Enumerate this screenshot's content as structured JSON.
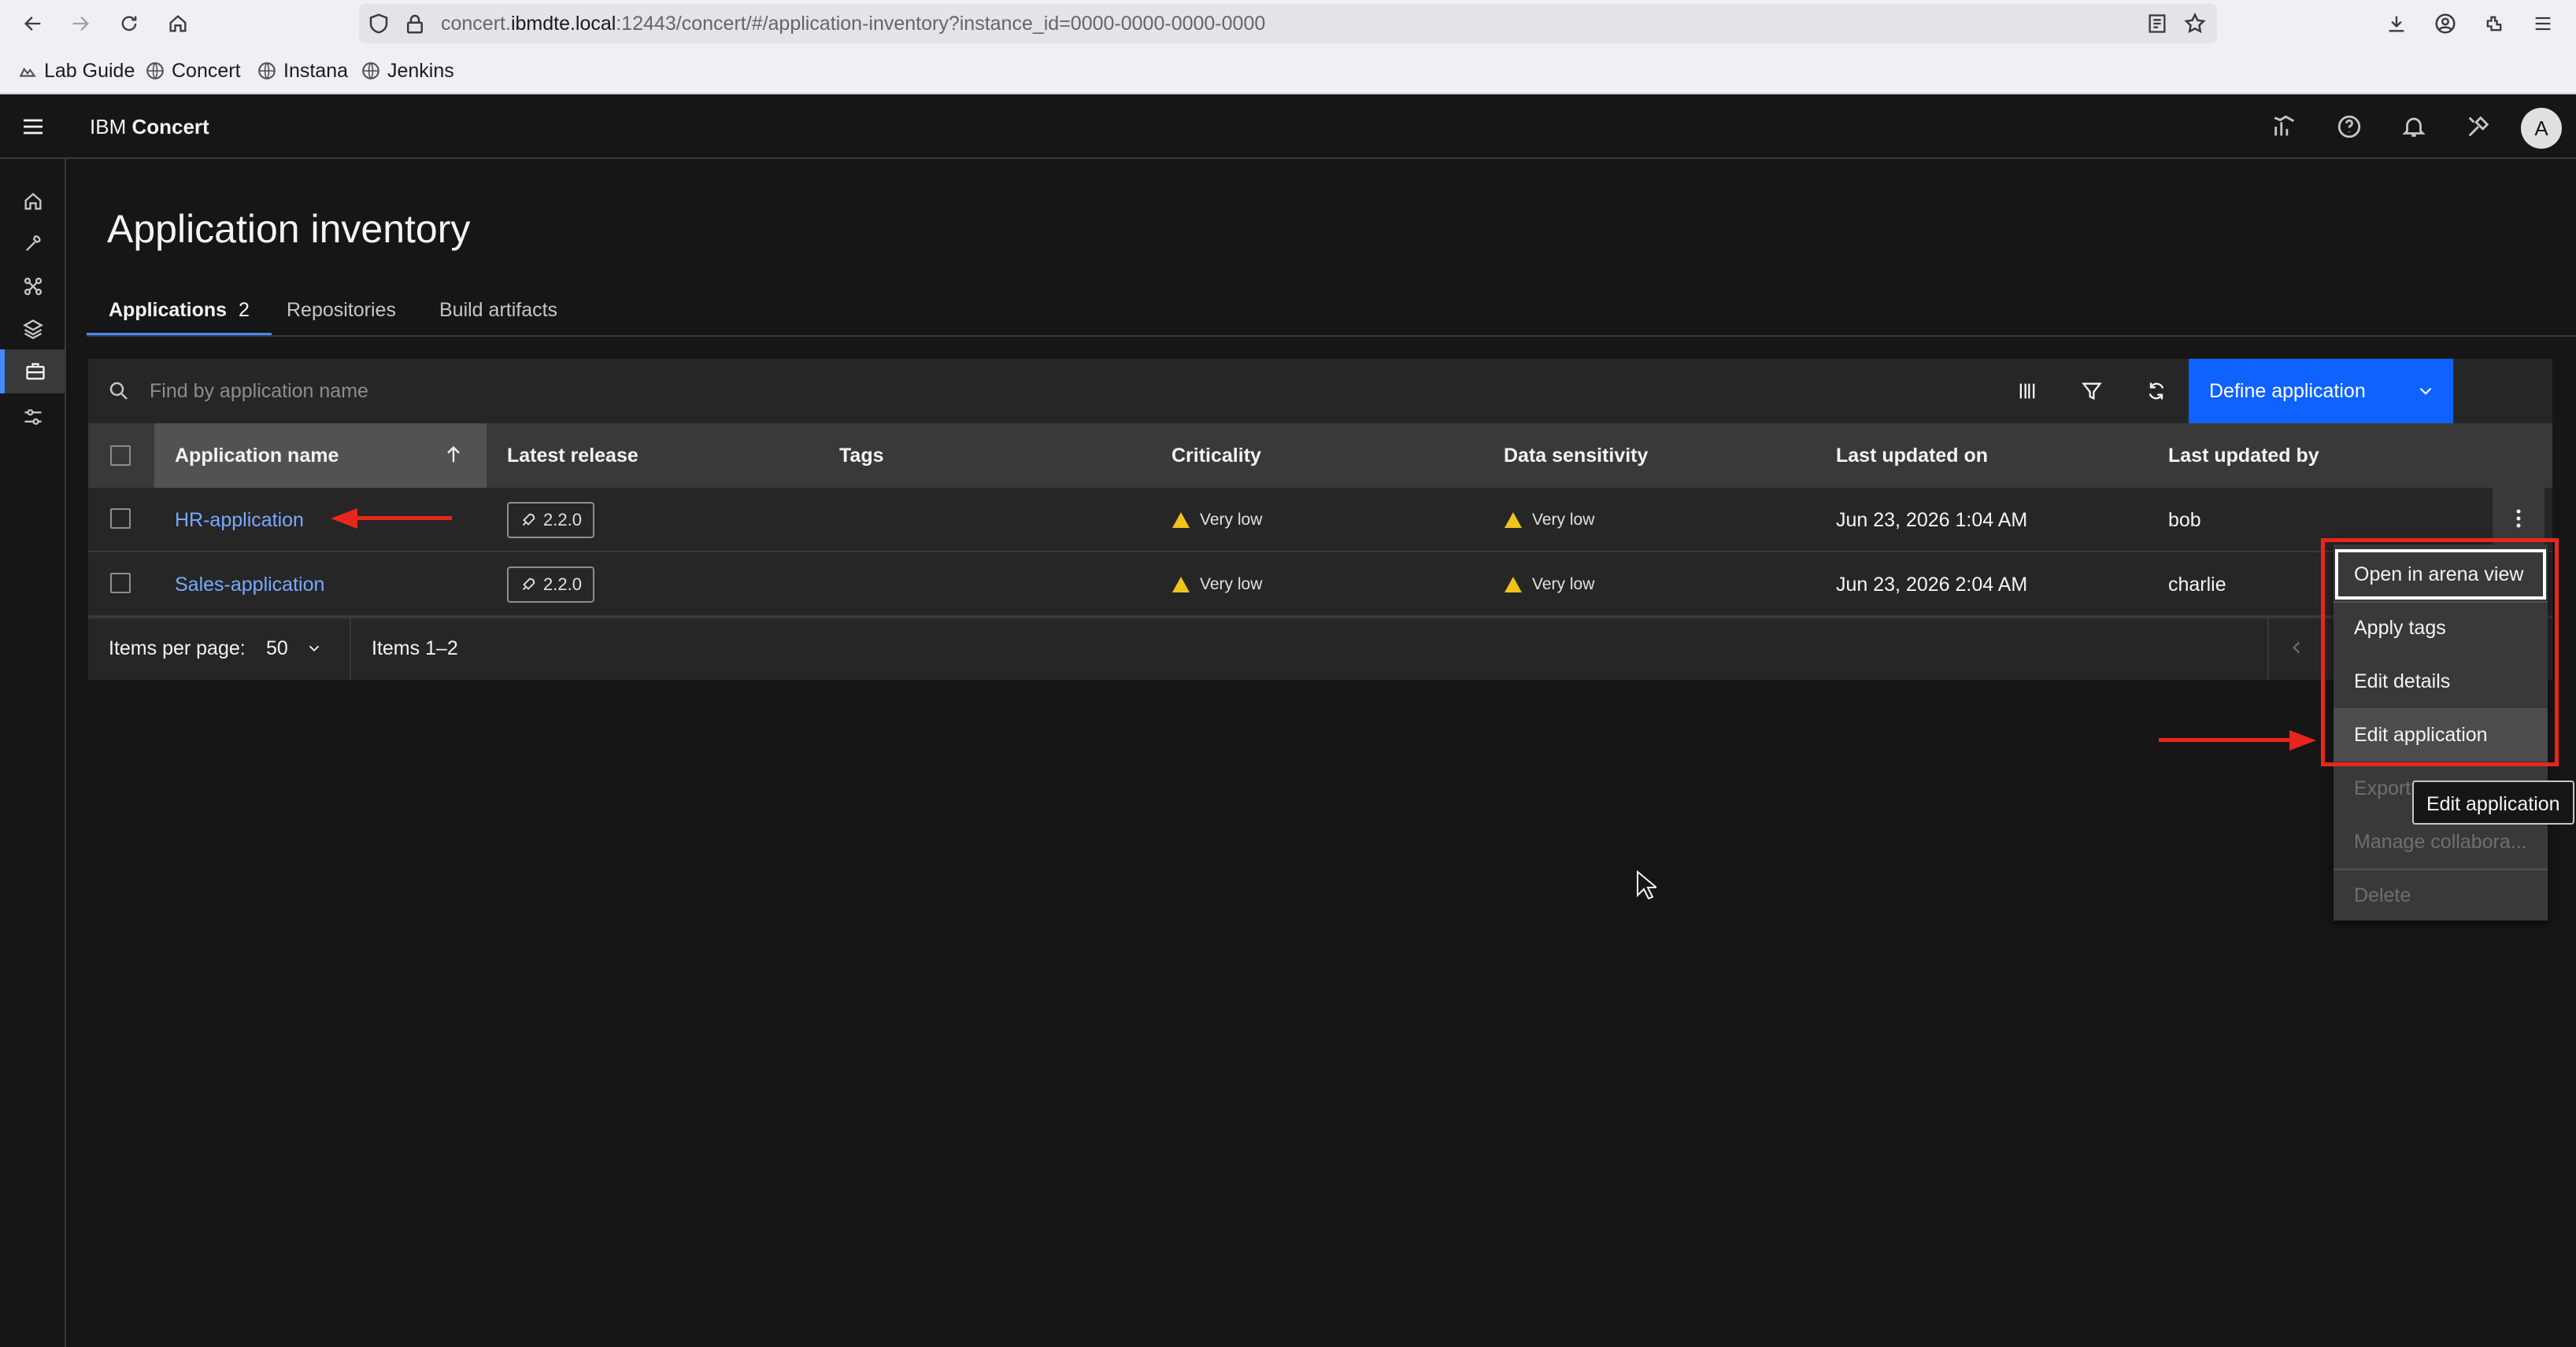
{
  "browser": {
    "url_prefix": "concert.",
    "url_domain": "ibmdte.local",
    "url_suffix": ":12443/concert/#/application-inventory?instance_id=0000-0000-0000-0000",
    "bookmarks": [
      "Lab Guide",
      "Concert",
      "Instana",
      "Jenkins"
    ]
  },
  "header": {
    "brand": "IBM",
    "product": "Concert",
    "avatar_initial": "A"
  },
  "page": {
    "title": "Application inventory",
    "tabs": [
      {
        "label": "Applications",
        "count": "2"
      },
      {
        "label": "Repositories"
      },
      {
        "label": "Build artifacts"
      }
    ]
  },
  "toolbar": {
    "search_placeholder": "Find by application name",
    "define_button": "Define application"
  },
  "table": {
    "columns": [
      "Application name",
      "Latest release",
      "Tags",
      "Criticality",
      "Data sensitivity",
      "Last updated on",
      "Last updated by"
    ],
    "rows": [
      {
        "name": "HR-application",
        "release": "2.2.0",
        "tags": "",
        "criticality": "Very low",
        "sensitivity": "Very low",
        "updated_on": "Jun 23, 2026 1:04 AM",
        "updated_by": "bob"
      },
      {
        "name": "Sales-application",
        "release": "2.2.0",
        "tags": "",
        "criticality": "Very low",
        "sensitivity": "Very low",
        "updated_on": "Jun 23, 2026 2:04 AM",
        "updated_by": "charlie"
      }
    ]
  },
  "pagination": {
    "items_per_page_label": "Items per page:",
    "items_per_page": "50",
    "range": "Items 1–2"
  },
  "menu": {
    "items": [
      "Open in arena view",
      "Apply tags",
      "Edit details",
      "Edit application",
      "Export",
      "Manage collabora...",
      "Delete"
    ],
    "tooltip": "Edit application"
  },
  "colors": {
    "accent": "#0f62fe",
    "link": "#78a9ff",
    "warning": "#f1c21b",
    "annotation": "#e8261b"
  }
}
